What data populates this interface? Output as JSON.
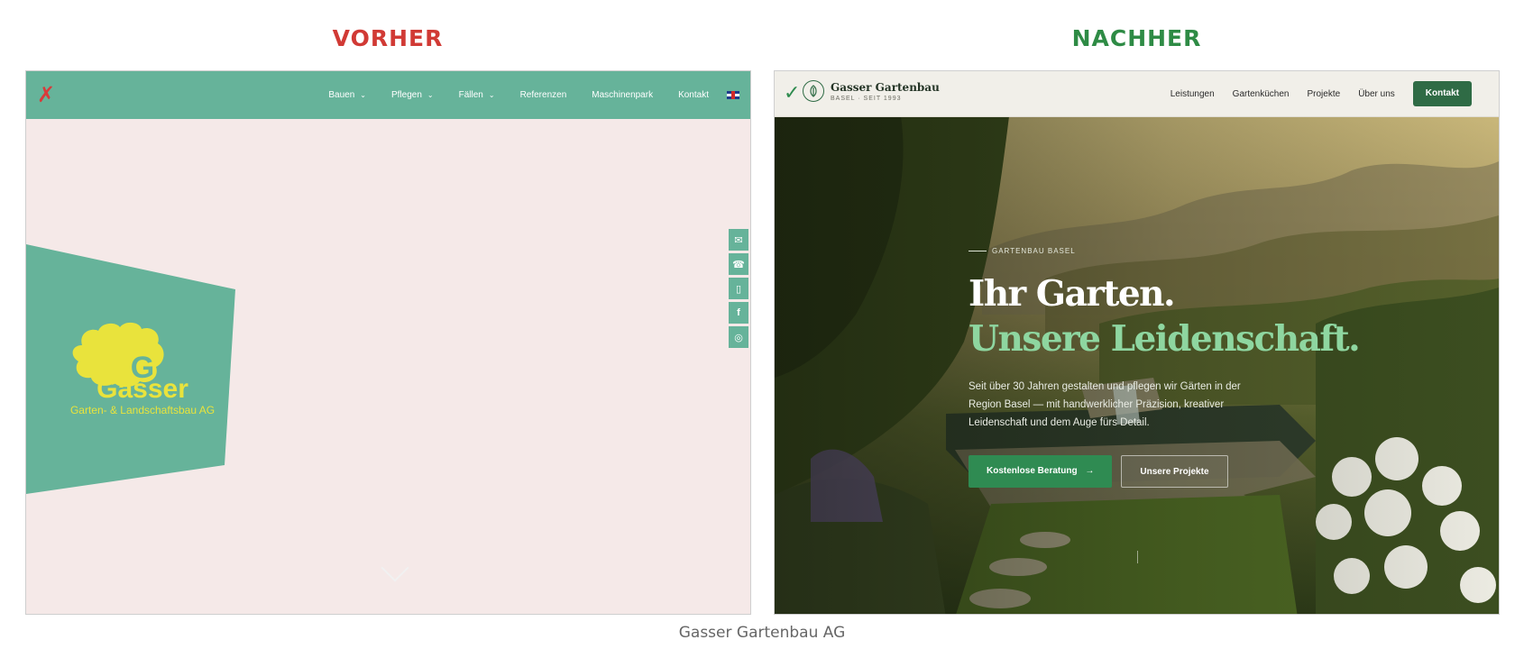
{
  "labels": {
    "before": "VORHER",
    "after": "NACHHER",
    "caption": "Gasser Gartenbau AG"
  },
  "colors": {
    "before_label": "#d13a35",
    "after_label": "#2e8b45",
    "before_accent": "#66b39a",
    "before_logo_yellow": "#e9e33c",
    "after_primary": "#2f6b45",
    "after_highlight": "#8ed6a0"
  },
  "before": {
    "status_mark": "✗",
    "nav": [
      {
        "label": "Bauen",
        "has_dropdown": true
      },
      {
        "label": "Pflegen",
        "has_dropdown": true
      },
      {
        "label": "Fällen",
        "has_dropdown": true
      },
      {
        "label": "Referenzen",
        "has_dropdown": false
      },
      {
        "label": "Maschinenpark",
        "has_dropdown": false
      },
      {
        "label": "Kontakt",
        "has_dropdown": false
      }
    ],
    "language_icon": "uk-flag-icon",
    "logo": {
      "letter": "G",
      "name": "Gasser",
      "subline": "Garten- & Landschaftsbau AG"
    },
    "social": [
      "envelope-icon",
      "phone-icon",
      "mobile-icon",
      "facebook-icon",
      "instagram-icon"
    ],
    "scroll_icon": "chevron-down-icon"
  },
  "after": {
    "status_mark": "✓",
    "brand": {
      "name": "Gasser Gartenbau",
      "tagline": "BASEL · SEIT 1993",
      "icon": "leaf-icon"
    },
    "nav": [
      "Leistungen",
      "Gartenküchen",
      "Projekte",
      "Über uns"
    ],
    "cta": "Kontakt",
    "hero": {
      "eyebrow": "GARTENBAU BASEL",
      "title_line1": "Ihr Garten.",
      "title_line2": "Unsere Leidenschaft.",
      "text": "Seit über 30 Jahren gestalten und pflegen wir Gärten in der Region Basel — mit handwerklicher Präzision, kreativer Leidenschaft und dem Auge fürs Detail.",
      "primary_button": "Kostenlose Beratung",
      "primary_icon": "arrow-right-icon",
      "secondary_button": "Unsere Projekte"
    }
  }
}
